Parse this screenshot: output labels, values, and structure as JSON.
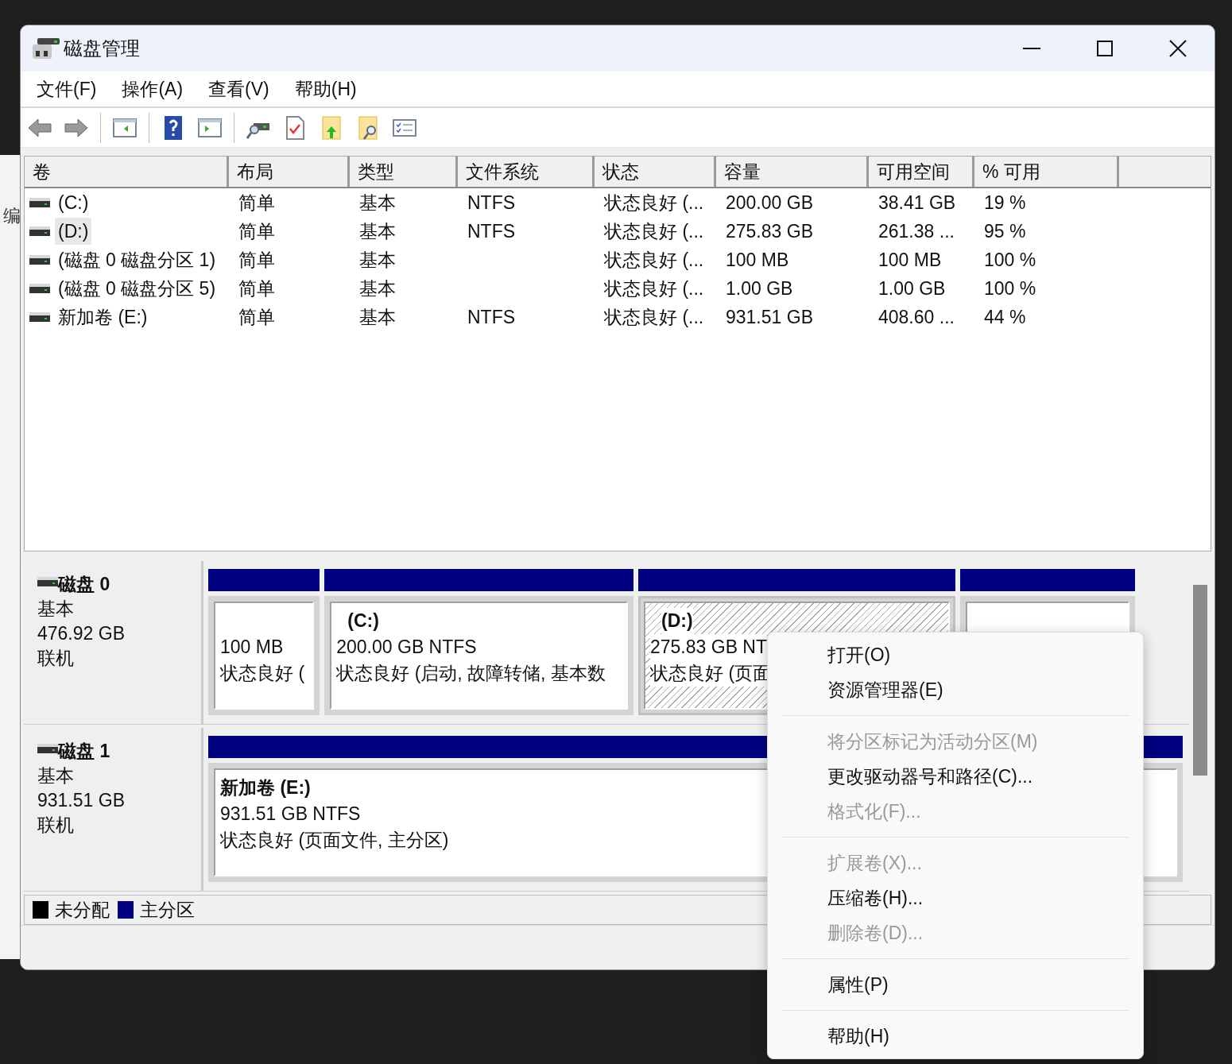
{
  "background_window": {
    "text": "编"
  },
  "window": {
    "title": "磁盘管理"
  },
  "menu": [
    "文件(F)",
    "操作(A)",
    "查看(V)",
    "帮助(H)"
  ],
  "volume_table": {
    "columns": [
      "卷",
      "布局",
      "类型",
      "文件系统",
      "状态",
      "容量",
      "可用空间",
      "% 可用"
    ],
    "rows": [
      {
        "volume": "(C:)",
        "layout": "简单",
        "type": "基本",
        "file_system": "NTFS",
        "status": "状态良好 (...",
        "capacity": "200.00 GB",
        "free": "38.41 GB",
        "percent": "19 %",
        "selected": false
      },
      {
        "volume": "(D:)",
        "layout": "简单",
        "type": "基本",
        "file_system": "NTFS",
        "status": "状态良好 (...",
        "capacity": "275.83 GB",
        "free": "261.38 ...",
        "percent": "95 %",
        "selected": true
      },
      {
        "volume": "(磁盘 0 磁盘分区 1)",
        "layout": "简单",
        "type": "基本",
        "status": "状态良好 (...",
        "capacity": "100 MB",
        "free": "100 MB",
        "percent": "100 %",
        "selected": false
      },
      {
        "volume": "(磁盘 0 磁盘分区 5)",
        "layout": "简单",
        "type": "基本",
        "status": "状态良好 (...",
        "capacity": "1.00 GB",
        "free": "1.00 GB",
        "percent": "100 %",
        "selected": false
      },
      {
        "volume": "新加卷 (E:)",
        "layout": "简单",
        "type": "基本",
        "file_system": "NTFS",
        "status": "状态良好 (...",
        "capacity": "931.51 GB",
        "free": "408.60 ...",
        "percent": "44 %",
        "selected": false
      }
    ]
  },
  "disks": [
    {
      "name": "磁盘 0",
      "type": "基本",
      "size": "476.92 GB",
      "status": "联机",
      "partitions": [
        {
          "size": "100 MB",
          "detail": "状态良好 (",
          "selected": false
        },
        {
          "name": "(C:)",
          "size": "200.00 GB NTFS",
          "detail": "状态良好 (启动, 故障转储, 基本数",
          "selected": false
        },
        {
          "name": "(D:)",
          "size": "275.83 GB NT",
          "detail": "状态良好 (页面",
          "selected": true
        },
        {
          "selected": false
        }
      ]
    },
    {
      "name": "磁盘 1",
      "type": "基本",
      "size": "931.51 GB",
      "status": "联机",
      "partitions": [
        {
          "name": "新加卷 (E:)",
          "size": "931.51 GB NTFS",
          "detail": "状态良好 (页面文件, 主分区)",
          "selected": false
        }
      ]
    }
  ],
  "legend": [
    {
      "label": "未分配",
      "color": "#000000"
    },
    {
      "label": "主分区",
      "color": "#000080"
    }
  ],
  "context_menu": [
    {
      "kind": "item",
      "label": "打开(O)",
      "disabled": false
    },
    {
      "kind": "item",
      "label": "资源管理器(E)",
      "disabled": false
    },
    {
      "kind": "separator"
    },
    {
      "kind": "item",
      "label": "将分区标记为活动分区(M)",
      "disabled": true
    },
    {
      "kind": "item",
      "label": "更改驱动器号和路径(C)...",
      "disabled": false
    },
    {
      "kind": "item",
      "label": "格式化(F)...",
      "disabled": true
    },
    {
      "kind": "separator"
    },
    {
      "kind": "item",
      "label": "扩展卷(X)...",
      "disabled": true
    },
    {
      "kind": "item",
      "label": "压缩卷(H)...",
      "disabled": false
    },
    {
      "kind": "item",
      "label": "删除卷(D)...",
      "disabled": true
    },
    {
      "kind": "separator"
    },
    {
      "kind": "item",
      "label": "属性(P)",
      "disabled": false
    },
    {
      "kind": "separator"
    },
    {
      "kind": "item",
      "label": "帮助(H)",
      "disabled": false
    }
  ]
}
